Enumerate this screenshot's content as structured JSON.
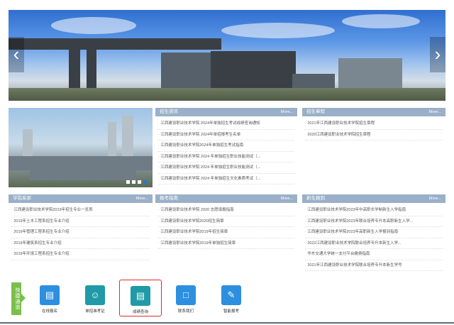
{
  "hero": {
    "prev": "‹",
    "next": "›"
  },
  "panels": {
    "recruit_news": {
      "title": "招生资讯",
      "more": "More...",
      "items": [
        "江西建设职业技术学院 2024年单独招生考试成绩查询通知",
        "江西建设职业技术学院 2024年单招报考生名单",
        "江西建设职业技术学院2024年单独招生考试指南",
        "江西建设职业技术学院 2024 年单独招生职业技能测试（...",
        "江西建设职业技术学院 2024 年单独招生职业技能测试（...",
        "江西建设职业技术学院 2024 年单独招生文化素质考试（..."
      ]
    },
    "recruit_rules": {
      "title": "招生章程",
      "more": "More...",
      "items": [
        "2021年江西建设职业技术学院招生章程",
        "2020江西建设职业技术学院招生章程"
      ]
    },
    "departments": {
      "title": "学院系部",
      "more": "More...",
      "items": [
        "江西建设职业技术学院2019年招生专业一览表",
        "2019年土木工程系招生专业介绍",
        "2019年管理工程系招生专业介绍",
        "2019年建筑系招生专业介绍",
        "2019年环境工程系招生专业介绍"
      ]
    },
    "guide": {
      "title": "报考指南",
      "more": "More...",
      "items": [
        "江西建设职业技术学院 2020 志愿填报指南",
        "江西建设职业技术学院2020招生简章",
        "江西建设职业技术学院2019年招生简章",
        "江西建设职业技术学院2019年单独招生简章"
      ]
    },
    "freshmen": {
      "title": "新生报到",
      "more": "More...",
      "items": [
        "江西建设职业技术学院2023年中高职长学制新生入学指南",
        "江西建设职业技术学院2023年联合培养专升本高职新生入学...",
        "江西建设职业技术学院2023年高职新生入学报到指南",
        "2022江西建设职业技术学院联合培养专升本新生入学...",
        "华东交通大学统一支付平台缴费指南",
        "2021年江西建设职业技术学院联合培养专升本新生学号"
      ]
    }
  },
  "quick": {
    "label": "快捷通道",
    "items": [
      {
        "label": "在线报名",
        "icon": "form-icon"
      },
      {
        "label": "单招准考证",
        "icon": "id-card-icon"
      },
      {
        "label": "成绩查询",
        "icon": "score-query-icon"
      },
      {
        "label": "联系我们",
        "icon": "monitor-icon"
      },
      {
        "label": "智能报考",
        "icon": "edit-doc-icon"
      }
    ]
  },
  "colors": {
    "panel_head": "#9ab0c8",
    "quick_green": "#7bbf4a",
    "icon_blue": "#2d8fe0",
    "icon_teal": "#1f9aa6",
    "highlight": "#e02a2a"
  }
}
